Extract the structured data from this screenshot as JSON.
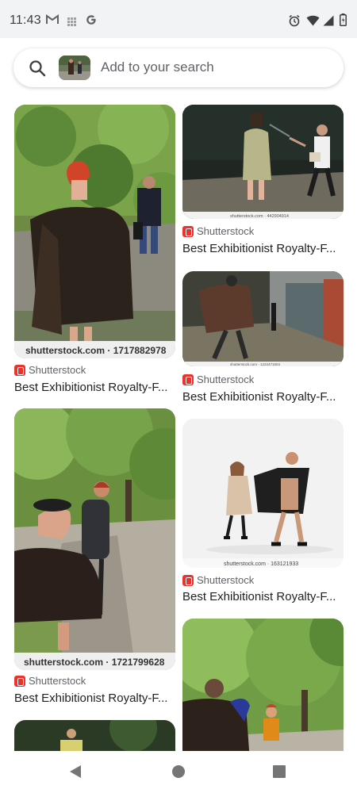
{
  "status_bar": {
    "time": "11:43",
    "left_icons": [
      "gmail-icon",
      "grid-icon",
      "google-icon"
    ],
    "right_icons": [
      "alarm-icon",
      "wifi-icon",
      "signal-icon",
      "battery-icon"
    ]
  },
  "search": {
    "placeholder": "Add to your search",
    "icon": "search-icon"
  },
  "results": [
    {
      "source": "Shutterstock",
      "title": "Best Exhibitionist Royalty-F...",
      "watermark": "shutterstock.com · 1717882978"
    },
    {
      "source": "Shutterstock",
      "title": "Best Exhibitionist Royalty-F...",
      "watermark": "shutterstock.com · 442904914"
    },
    {
      "source": "Shutterstock",
      "title": "Best Exhibitionist Royalty-F...",
      "watermark": "shutterstock.com · 1222471504"
    },
    {
      "source": "Shutterstock",
      "title": "Best Exhibitionist Royalty-F...",
      "watermark": "shutterstock.com · 1721799628"
    },
    {
      "source": "Shutterstock",
      "title": "Best Exhibitionist Royalty-F...",
      "watermark": "shutterstock.com · 163121933"
    }
  ],
  "nav_bar": {
    "buttons": [
      "back-icon",
      "home-icon",
      "recents-icon"
    ]
  },
  "colors": {
    "status_bar_bg": "#f1f3f4",
    "source_icon": "#e8332f",
    "text_primary": "#202124",
    "text_secondary": "#5f6368"
  }
}
